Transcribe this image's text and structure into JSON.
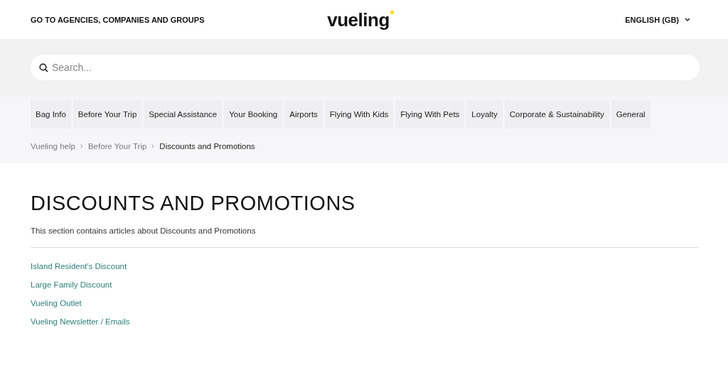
{
  "header": {
    "agencies_link": "GO TO AGENCIES, COMPANIES AND GROUPS",
    "logo": "vueling",
    "language": "ENGLISH (GB)"
  },
  "search": {
    "placeholder": "Search..."
  },
  "categories": [
    "Bag Info",
    "Before Your Trip",
    "Special Assistance",
    "Your Booking",
    "Airports",
    "Flying With Kids",
    "Flying With Pets",
    "Loyalty",
    "Corporate & Sustainability",
    "General"
  ],
  "breadcrumbs": [
    "Vueling help",
    "Before Your Trip",
    "Discounts and Promotions"
  ],
  "section": {
    "title": "DISCOUNTS AND PROMOTIONS",
    "description": "This section contains articles about Discounts and Promotions"
  },
  "articles": [
    "Island Resident's Discount",
    "Large Family Discount",
    "Vueling Outlet",
    "Vueling Newsletter / Emails"
  ]
}
